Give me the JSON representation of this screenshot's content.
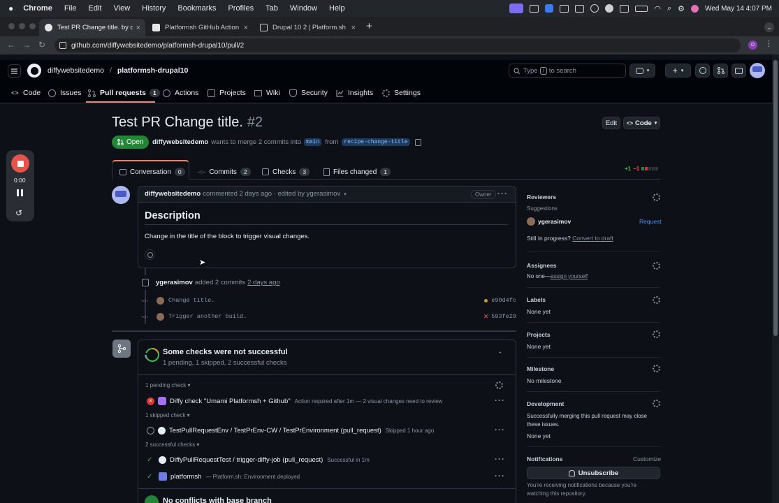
{
  "mac_menu": {
    "app": "Chrome",
    "items": [
      "File",
      "Edit",
      "View",
      "History",
      "Bookmarks",
      "Profiles",
      "Tab",
      "Window",
      "Help"
    ],
    "clock": "Wed May 14  4:07 PM"
  },
  "browser": {
    "tabs": [
      {
        "title": "Test PR Change title. by diffy",
        "active": true
      },
      {
        "title": "Platformsh GitHub Action | D",
        "active": false
      },
      {
        "title": "Drupal 10 2 | Platform.sh",
        "active": false
      }
    ],
    "url": "github.com/diffywebsitedemo/platformsh-drupal10/pull/2"
  },
  "github": {
    "owner": "diffywebsitedemo",
    "separator": "/",
    "repo": "platformsh-drupal10",
    "search_prefix": "Type",
    "search_key": "/",
    "search_suffix": "to search",
    "repo_tabs": [
      {
        "label": "Code",
        "icon": "code-icon"
      },
      {
        "label": "Issues",
        "icon": "issue-icon"
      },
      {
        "label": "Pull requests",
        "icon": "pull-request-icon",
        "count": "1",
        "active": true
      },
      {
        "label": "Actions",
        "icon": "play-icon"
      },
      {
        "label": "Projects",
        "icon": "table-icon"
      },
      {
        "label": "Wiki",
        "icon": "book-icon"
      },
      {
        "label": "Security",
        "icon": "shield-icon"
      },
      {
        "label": "Insights",
        "icon": "graph-icon"
      },
      {
        "label": "Settings",
        "icon": "gear-icon"
      }
    ]
  },
  "recorder": {
    "time": "0:00"
  },
  "pr": {
    "title": "Test PR Change title.",
    "number": "#2",
    "edit_label": "Edit",
    "code_label": "Code",
    "state": "Open",
    "author": "diffywebsitedemo",
    "merge_text": "wants to merge 2 commits into",
    "base": "main",
    "from_text": "from",
    "head": "recipe-change-title",
    "tabs": [
      {
        "label": "Conversation",
        "count": "0"
      },
      {
        "label": "Commits",
        "count": "2"
      },
      {
        "label": "Checks",
        "count": "3"
      },
      {
        "label": "Files changed",
        "count": "1"
      }
    ],
    "diff_add": "+1",
    "diff_del": "−1"
  },
  "comment": {
    "author": "diffywebsitedemo",
    "meta": "commented 2 days ago · edited by ygerasimov",
    "badge": "Owner",
    "heading": "Description",
    "body": "Change in the title of the block to trigger visual changes."
  },
  "commits_event": {
    "actor": "ygerasimov",
    "text": "added 2 commits",
    "time": "2 days ago",
    "commits": [
      {
        "message": "Change title.",
        "sha": "e90d4fc",
        "status": "pending"
      },
      {
        "message": "Trigger another build.",
        "sha": "593fe29",
        "status": "failed"
      }
    ]
  },
  "checks": {
    "title": "Some checks were not successful",
    "summary": "1 pending, 1 skipped, 2 successful checks",
    "pending_header": "1 pending check",
    "skipped_header": "1 skipped check",
    "successful_header": "2 successful checks",
    "items": [
      {
        "name": "Diffy check \"Umami Platformsh + Github\"",
        "status": "Action required after 1m — 2 visual changes need to review"
      },
      {
        "name": "TestPullRequestEnv / TestPrEnv-CW / TestPrEnvironment (pull_request)",
        "status": "Skipped 1 hour ago"
      },
      {
        "name": "DiffyPullRequestTest / trigger-diffy-job (pull_request)",
        "status": "Successful in 1m"
      },
      {
        "name": "platformsh",
        "status": "— Platform.sh: Environment deployed"
      }
    ],
    "no_conflicts": "No conflicts with base branch"
  },
  "sidebar": {
    "reviewers": "Reviewers",
    "suggestions": "Suggestions",
    "suggested_reviewer": "ygerasimov",
    "request": "Request",
    "still_in_progress": "Still in progress?",
    "convert_to_draft": "Convert to draft",
    "assignees": "Assignees",
    "no_one": "No one—",
    "assign_yourself": "assign yourself",
    "labels": "Labels",
    "labels_value": "None yet",
    "projects": "Projects",
    "projects_value": "None yet",
    "milestone": "Milestone",
    "milestone_value": "No milestone",
    "development": "Development",
    "development_text": "Successfully merging this pull request may close these issues.",
    "development_value": "None yet",
    "notifications": "Notifications",
    "customize": "Customize",
    "unsubscribe": "Unsubscribe",
    "notify_reason": "You're receiving notifications because you're watching this repository."
  }
}
